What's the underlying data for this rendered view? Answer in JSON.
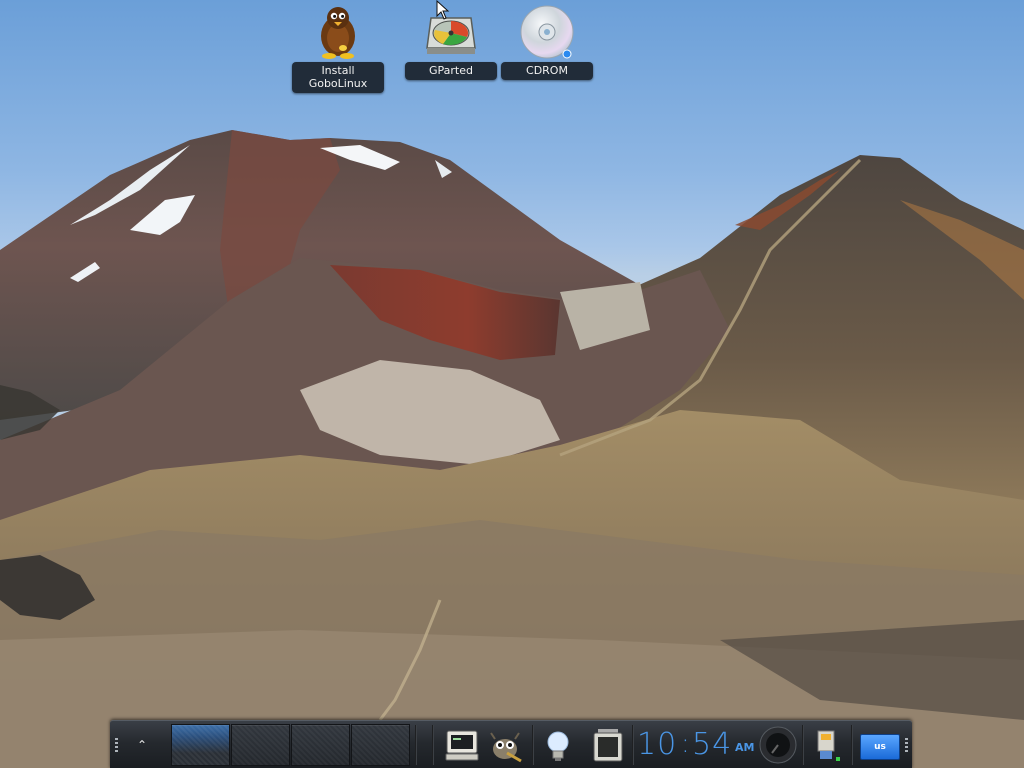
{
  "desktop": {
    "icons": [
      {
        "label": "Install\nGoboLinux",
        "icon": "gobolinux-penguin-icon"
      },
      {
        "label": "GParted",
        "icon": "gparted-disk-icon"
      },
      {
        "label": "CDROM",
        "icon": "cdrom-disc-icon"
      }
    ]
  },
  "panel": {
    "expand_button": "⌃",
    "workspaces": [
      {
        "name": "workspace-1",
        "active": true
      },
      {
        "name": "workspace-2",
        "active": false
      },
      {
        "name": "workspace-3",
        "active": false
      },
      {
        "name": "workspace-4",
        "active": false
      }
    ],
    "launchers": [
      {
        "icon": "terminal-computer-icon"
      },
      {
        "icon": "gimp-icon"
      }
    ],
    "tray": [
      {
        "icon": "lightbulb-icon"
      },
      {
        "icon": "battery-icon"
      },
      {
        "icon": "volume-knob-icon"
      },
      {
        "icon": "network-cable-icon"
      }
    ],
    "clock": {
      "hours": "10",
      "minutes": "54",
      "ampm": "AM"
    },
    "keyboard_layout": "us"
  },
  "colors": {
    "clock_accent": "#4a96e6",
    "active_workspace": "#3c6ea8",
    "keyboard_badge": "#2b80f0"
  }
}
